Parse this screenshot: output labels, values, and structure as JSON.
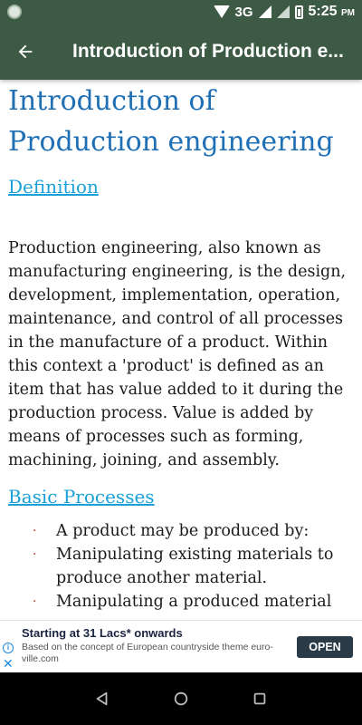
{
  "status_bar": {
    "network": "3G",
    "time": "5:25",
    "ampm": "PM"
  },
  "app_bar": {
    "title": "Introduction of Production e..."
  },
  "content": {
    "heading": "Introduction of Production engineering",
    "definition_link": "Definition",
    "definition_text": "Production engineering, also known as manufacturing engineering, is the design, development, implementation, operation, maintenance, and control of all processes in the manufacture of a product. Within this context a 'product' is defined as an item that has value added to it during the production process. Value is added by means of processes such as forming, machining, joining, and assembly.",
    "basic_processes_link": "Basic Processes",
    "bullet_marker": "·",
    "bullets": [
      "A product may be produced by:",
      "Manipulating existing materials to produce another material.",
      "Manipulating a produced material"
    ]
  },
  "ad": {
    "title": "Starting at 31 Lacs* onwards",
    "description": "Based on the concept of European countryside theme euro-ville.com",
    "open_label": "OPEN",
    "info_glyph": "i",
    "close_glyph": "✕"
  }
}
